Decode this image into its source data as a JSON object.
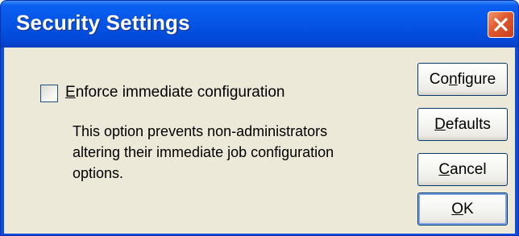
{
  "window": {
    "title": "Security Settings"
  },
  "titlebar": {
    "close_icon": "close-icon"
  },
  "options": {
    "enforce_label_first": "E",
    "enforce_label_rest": "nforce immediate configuration",
    "enforce_checked": false,
    "description_line1": "This option prevents non-administrators",
    "description_line2": "altering their immediate job configuration",
    "description_line3": "options."
  },
  "buttons": {
    "configure_pre": "Co",
    "configure_accel": "n",
    "configure_post": "figure",
    "defaults_accel": "D",
    "defaults_post": "efaults",
    "cancel_accel": "C",
    "cancel_post": "ancel",
    "ok_accel": "O",
    "ok_post": "K"
  },
  "colors": {
    "titlebar": "#0554e6",
    "client_background": "#ece9d8",
    "close_button": "#e0572c",
    "button_border": "#003c74"
  }
}
